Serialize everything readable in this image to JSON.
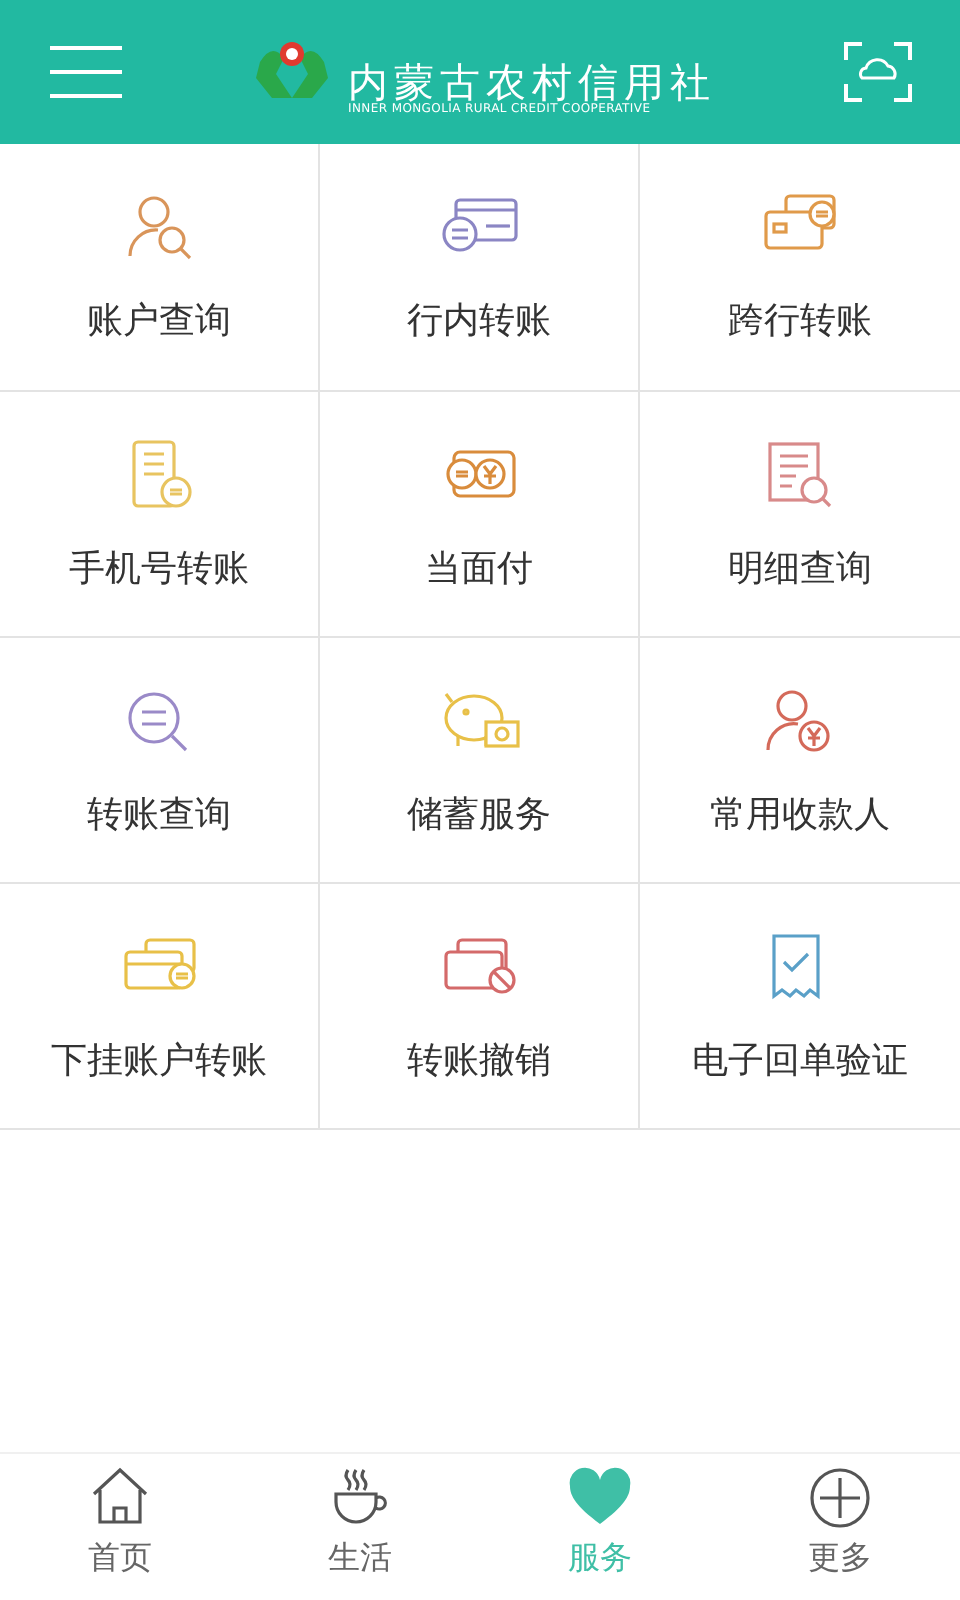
{
  "header": {
    "title": "内蒙古农村信用社",
    "subtitle": "INNER MONGOLIA RURAL CREDIT COOPERATIVE"
  },
  "services": [
    {
      "label": "账户查询"
    },
    {
      "label": "行内转账"
    },
    {
      "label": "跨行转账"
    },
    {
      "label": "手机号转账"
    },
    {
      "label": "当面付"
    },
    {
      "label": "明细查询"
    },
    {
      "label": "转账查询"
    },
    {
      "label": "储蓄服务"
    },
    {
      "label": "常用收款人"
    },
    {
      "label": "下挂账户转账"
    },
    {
      "label": "转账撤销"
    },
    {
      "label": "电子回单验证"
    }
  ],
  "tabs": [
    {
      "label": "首页",
      "selected": false
    },
    {
      "label": "生活",
      "selected": false
    },
    {
      "label": "服务",
      "selected": true
    },
    {
      "label": "更多",
      "selected": false
    }
  ]
}
